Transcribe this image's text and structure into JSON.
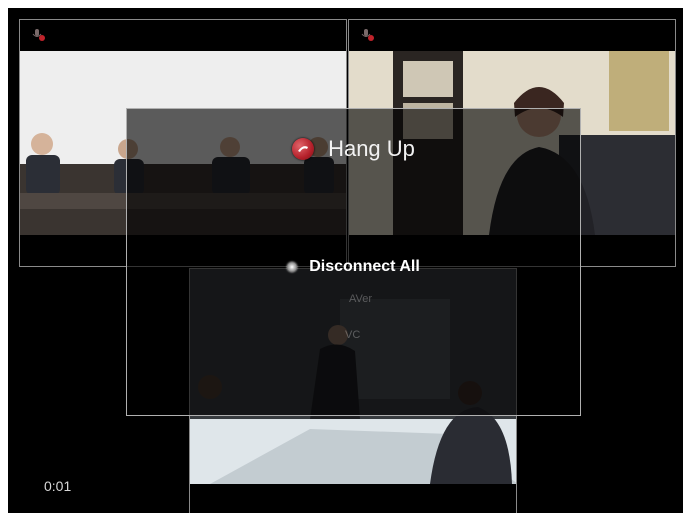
{
  "dialog": {
    "title": "Hang Up",
    "option": "Disconnect All",
    "watermark_lines": [
      "AVer",
      "VC"
    ]
  },
  "call": {
    "timer": "0:01"
  },
  "tiles": [
    {
      "name": "video-tile-1",
      "mic_icon": "mic-muted-icon"
    },
    {
      "name": "video-tile-2",
      "mic_icon": "mic-muted-icon"
    },
    {
      "name": "video-tile-3",
      "mic_icon": "mic-muted-icon"
    }
  ],
  "colors": {
    "background": "#000000",
    "tile_border": "#8a8a8a",
    "hangup_red": "#b4202a",
    "text": "#ffffff"
  }
}
